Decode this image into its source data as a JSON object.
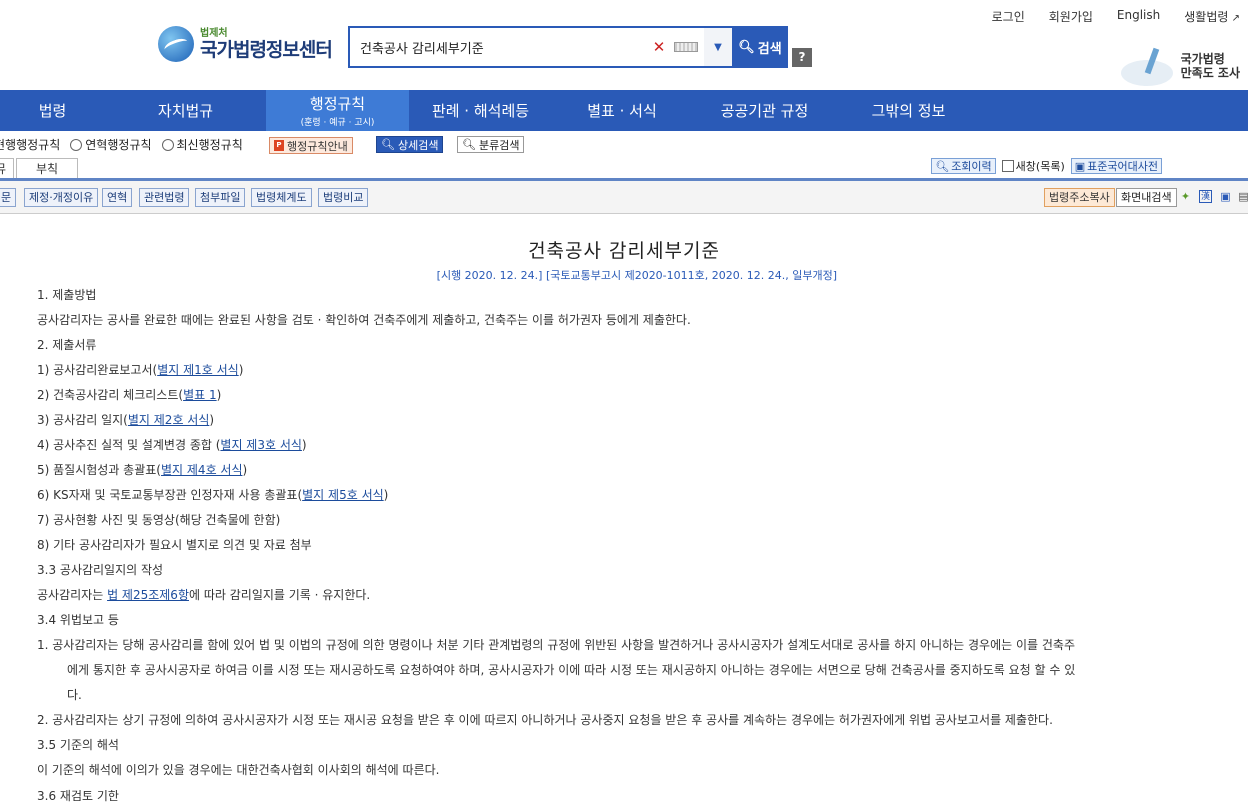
{
  "util": {
    "login": "로그인",
    "signup": "회원가입",
    "english": "English",
    "life": "생활법령"
  },
  "logo": {
    "small": "법제처",
    "big": "국가법령정보센터"
  },
  "search": {
    "query": "건축공사 감리세부기준",
    "button": "검색",
    "clear": "✕",
    "help": "?"
  },
  "survey": {
    "line1": "국가법령",
    "line2": "만족도 조사"
  },
  "nav": [
    {
      "label": "법령",
      "sub": ""
    },
    {
      "label": "자치법규",
      "sub": ""
    },
    {
      "label": "행정규칙",
      "sub": "(훈령 · 예규 · 고시)"
    },
    {
      "label": "판례 · 해석례등",
      "sub": ""
    },
    {
      "label": "별표 · 서식",
      "sub": ""
    },
    {
      "label": "공공기관 규정",
      "sub": ""
    },
    {
      "label": "그밖의 정보",
      "sub": ""
    }
  ],
  "filters": {
    "current": "현행행정규칙",
    "history": "연혁행정규칙",
    "recent": "최신행정규칙",
    "guide": "행정규칙안내",
    "detail": "상세검색",
    "category": "분류검색"
  },
  "tabs": {
    "a": "뮤",
    "b": "부칙"
  },
  "right_tools": {
    "history": "조회이력",
    "newwin": "새창(목록)",
    "dict": "표준국어대사전"
  },
  "toolbar": {
    "t1": "문",
    "t2": "제정·개정이유",
    "t3": "연혁",
    "t4": "관련법령",
    "t5": "첨부파일",
    "t6": "법령체계도",
    "t7": "법령비교",
    "copy": "법령주소복사",
    "find": "화면내검색"
  },
  "doc": {
    "title": "건축공사 감리세부기준",
    "sub": "[시행 2020. 12. 24.] [국토교통부고시 제2020-1011호, 2020. 12. 24., 일부개정]",
    "l1": "1. 제출방법",
    "l2": "공사감리자는 공사를 완료한 때에는 완료된 사항을 검토 · 확인하여 건축주에게 제출하고, 건축주는 이를 허가권자 등에게 제출한다.",
    "l3": "2. 제출서류",
    "l4a": "1) 공사감리완료보고서(",
    "l4l": "별지 제1호 서식",
    "l4b": ")",
    "l5a": "2) 건축공사감리 체크리스트(",
    "l5l": "별표 1",
    "l5b": ")",
    "l6a": "3) 공사감리 일지(",
    "l6l": "별지 제2호 서식",
    "l6b": ")",
    "l7a": "4) 공사추진 실적 및 설계변경 종합 (",
    "l7l": "별지 제3호 서식",
    "l7b": ")",
    "l8a": "5) 품질시험성과 총괄표(",
    "l8l": "별지 제4호 서식",
    "l8b": ")",
    "l9a": "6) KS자재 및 국토교통부장관 인정자재 사용 총괄표(",
    "l9l": "별지 제5호 서식",
    "l9b": ")",
    "l10": "7) 공사현황 사진 및 동영상(해당 건축물에 한함)",
    "l11": "8) 기타 공사감리자가 필요시 별지로 의견 및 자료 첨부",
    "l12": "3.3 공사감리일지의 작성",
    "l13a": "공사감리자는 ",
    "l13l": "법 제25조제6항",
    "l13b": "에 따라 감리일지를 기록 · 유지한다.",
    "l14": "3.4 위법보고 등",
    "l15": "1. 공사감리자는 당해 공사감리를 함에 있어 법 및 이법의 규정에 의한 명령이나 처분 기타 관계법령의 규정에 위반된 사항을 발견하거나 공사시공자가 설계도서대로 공사를 하지 아니하는 경우에는 이를 건축주",
    "l16": "에게 통지한 후 공사시공자로 하여금 이를 시정 또는 재시공하도록 요청하여야 하며, 공사시공자가 이에 따라 시정 또는 재시공하지 아니하는 경우에는 서면으로 당해 건축공사를 중지하도록 요청 할 수 있",
    "l17": "다.",
    "l18": "2. 공사감리자는 상기 규정에 의하여 공사시공자가 시정 또는 재시공 요청을 받은 후 이에 따르지 아니하거나 공사중지 요청을 받은 후 공사를 계속하는 경우에는 허가권자에게 위법 공사보고서를 제출한다.",
    "l19": "3.5 기준의 해석",
    "l20": "이 기준의 해석에 이의가 있을 경우에는 대한건축사협회 이사회의 해석에 따른다.",
    "l21": "3.6 재검토 기한"
  }
}
